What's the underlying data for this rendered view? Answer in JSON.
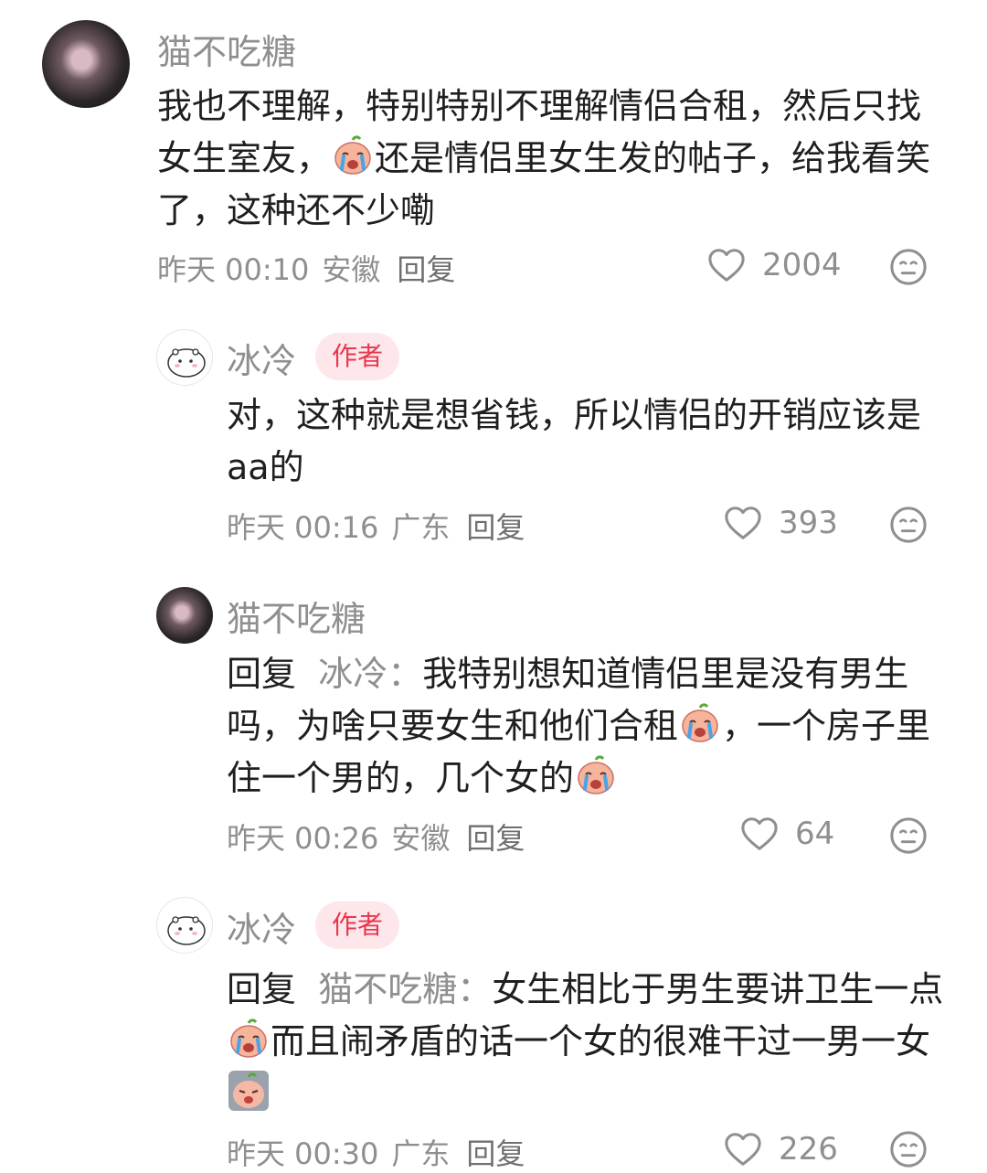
{
  "comments": [
    {
      "author": "猫不吃糖",
      "content_parts": [
        "我也不理解，特别特别不理解情侣合租，然后只找女生室友，",
        "还是情侣里女生发的帖子，给我看笑了，这种还不少嘞"
      ],
      "time": "昨天 00:10",
      "location": "安徽",
      "reply_label": "回复",
      "likes": "2004"
    },
    {
      "author": "冰冷",
      "badge": "作者",
      "content": "对，这种就是想省钱，所以情侣的开销应该是aa的",
      "time": "昨天 00:16",
      "location": "广东",
      "reply_label": "回复",
      "likes": "393"
    },
    {
      "author": "猫不吃糖",
      "reply_prefix": "回复",
      "reply_target": "冰冷：",
      "content_parts": [
        "我特别想知道情侣里是没有男生吗，为啥只要女生和他们合租",
        "，一个房子里住一个男的，几个女的"
      ],
      "time": "昨天 00:26",
      "location": "安徽",
      "reply_label": "回复",
      "likes": "64"
    },
    {
      "author": "冰冷",
      "badge": "作者",
      "reply_prefix": "回复",
      "reply_target": "猫不吃糖：",
      "content_parts": [
        "女生相比于男生要讲卫生一点",
        "而且闹矛盾的话一个女的很难干过一男一女"
      ],
      "time": "昨天 00:30",
      "location": "广东",
      "reply_label": "回复",
      "likes": "226"
    }
  ],
  "icons": {
    "like": "heart-outline-icon",
    "dislike": "neutral-face-icon",
    "emoji_cry": "crying-peach-emoji",
    "emoji_shy": "shy-peach-emoji"
  },
  "colors": {
    "name": "#8f8f8f",
    "text": "#1f1f1f",
    "badge_bg": "#fde7ea",
    "badge_text": "#e8364e"
  }
}
